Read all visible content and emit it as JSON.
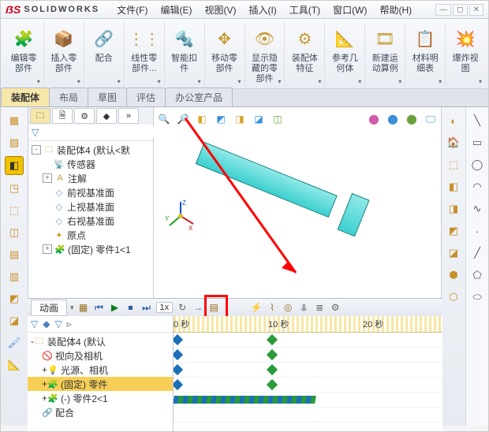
{
  "title": {
    "brand_prefix": "S",
    "brand": "SOLIDWORKS"
  },
  "menu": {
    "file": "文件(F)",
    "edit": "编辑(E)",
    "view": "视图(V)",
    "insert": "插入(I)",
    "tools": "工具(T)",
    "window": "窗口(W)",
    "help": "帮助(H)"
  },
  "ribbon": [
    {
      "id": "edit-part",
      "label": "编辑零\n部件"
    },
    {
      "id": "insert-part",
      "label": "插入零\n部件"
    },
    {
      "id": "mate",
      "label": "配合"
    },
    {
      "id": "linear-pattern",
      "label": "线性零\n部件..."
    },
    {
      "id": "smart-fastener",
      "label": "智能扣\n件"
    },
    {
      "id": "move-part",
      "label": "移动零\n部件"
    },
    {
      "id": "show-hidden",
      "label": "显示隐\n藏的零\n部件"
    },
    {
      "id": "assembly-feature",
      "label": "装配体\n特征"
    },
    {
      "id": "ref-geom",
      "label": "参考几\n何体"
    },
    {
      "id": "new-motion",
      "label": "新建运\n动算例"
    },
    {
      "id": "bom",
      "label": "材料明\n细表"
    },
    {
      "id": "exploded",
      "label": "爆炸视\n图"
    }
  ],
  "docTabs": [
    {
      "id": "assembly",
      "label": "装配体",
      "active": true
    },
    {
      "id": "layout",
      "label": "布局"
    },
    {
      "id": "sketch",
      "label": "草图"
    },
    {
      "id": "evaluate",
      "label": "评估"
    },
    {
      "id": "office",
      "label": "办公室产品"
    }
  ],
  "featureTree": {
    "filter_placeholder": "",
    "root": "装配体4 (默认<默",
    "nodes": [
      {
        "icon": "sensor",
        "label": "传感器"
      },
      {
        "icon": "annotation",
        "label": "注解",
        "exp": "+"
      },
      {
        "icon": "plane",
        "label": "前视基准面"
      },
      {
        "icon": "plane",
        "label": "上视基准面"
      },
      {
        "icon": "plane",
        "label": "右视基准面"
      },
      {
        "icon": "origin",
        "label": "原点"
      },
      {
        "icon": "part",
        "label": "(固定) 零件1<1",
        "exp": "+"
      }
    ]
  },
  "triad": {
    "x": "X",
    "y": "Y",
    "z": "Z"
  },
  "motion": {
    "tab": "动画",
    "speed": "1x",
    "ruler": [
      {
        "pos": 0,
        "label": "0 秒"
      },
      {
        "pos": 120,
        "label": "10 秒"
      },
      {
        "pos": 240,
        "label": "20 秒"
      }
    ],
    "tree": [
      {
        "label": "装配体4 (默认",
        "exp": "-",
        "indent": 0,
        "icon": "asm"
      },
      {
        "label": "视向及相机",
        "exp": "",
        "indent": 1,
        "icon": "no"
      },
      {
        "label": "光源、相机",
        "exp": "+",
        "indent": 1,
        "icon": "light"
      },
      {
        "label": "(固定) 零件",
        "exp": "+",
        "indent": 1,
        "icon": "part",
        "sel": true
      },
      {
        "label": "(-) 零件2<1",
        "exp": "+",
        "indent": 1,
        "icon": "part"
      },
      {
        "label": "配合",
        "exp": "",
        "indent": 1,
        "icon": "mate"
      }
    ]
  }
}
